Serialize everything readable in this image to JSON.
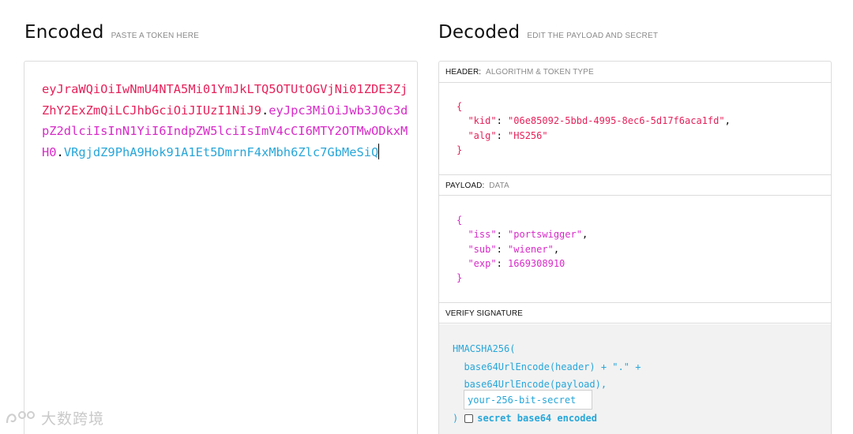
{
  "encoded": {
    "title": "Encoded",
    "subtitle": "PASTE A TOKEN HERE",
    "token_header": "eyJraWQiOiIwNmU4NTA5Mi01YmJkLTQ5OTUtOGVjNi01ZDE3ZjZhY2ExZmQiLCJhbGciOiJIUzI1NiJ9",
    "token_payload": "eyJpc3MiOiJwb3J0c3dpZ2dlciIsInN1YiI6IndpZW5lciIsImV4cCI6MTY2OTMwODkxMH0",
    "token_signature": "VRgjdZ9PhA9Hok91A1Et5DmrnF4xMbh6Zlc7GbMeSiQ",
    "dot": "."
  },
  "decoded": {
    "title": "Decoded",
    "subtitle": "EDIT THE PAYLOAD AND SECRET",
    "header_section": {
      "label": "HEADER:",
      "sub": "ALGORITHM & TOKEN TYPE"
    },
    "payload_section": {
      "label": "PAYLOAD:",
      "sub": "DATA"
    },
    "verify_section": {
      "label": "VERIFY SIGNATURE"
    },
    "header_json": {
      "open": "{",
      "close": "}",
      "kid_key": "\"kid\"",
      "kid_val": "\"06e85092-5bbd-4995-8ec6-5d17f6aca1fd\"",
      "alg_key": "\"alg\"",
      "alg_val": "\"HS256\""
    },
    "payload_json": {
      "open": "{",
      "close": "}",
      "iss_key": "\"iss\"",
      "iss_val": "\"portswigger\"",
      "sub_key": "\"sub\"",
      "sub_val": "\"wiener\"",
      "exp_key": "\"exp\"",
      "exp_val": "1669308910"
    },
    "verify": {
      "line1": "HMACSHA256(",
      "line2": "  base64UrlEncode(header) + \".\" +",
      "line3": "  base64UrlEncode(payload),",
      "secret_value": "your-256-bit-secret",
      "close_paren": ")",
      "b64_label": "secret base64 encoded",
      "b64_checked": false
    }
  },
  "watermark": {
    "text": "大数跨境",
    "icon": "brand-logo-icon"
  },
  "colors": {
    "header": "#e6215a",
    "payload": "#d82ac8",
    "signature": "#27a6d9"
  }
}
